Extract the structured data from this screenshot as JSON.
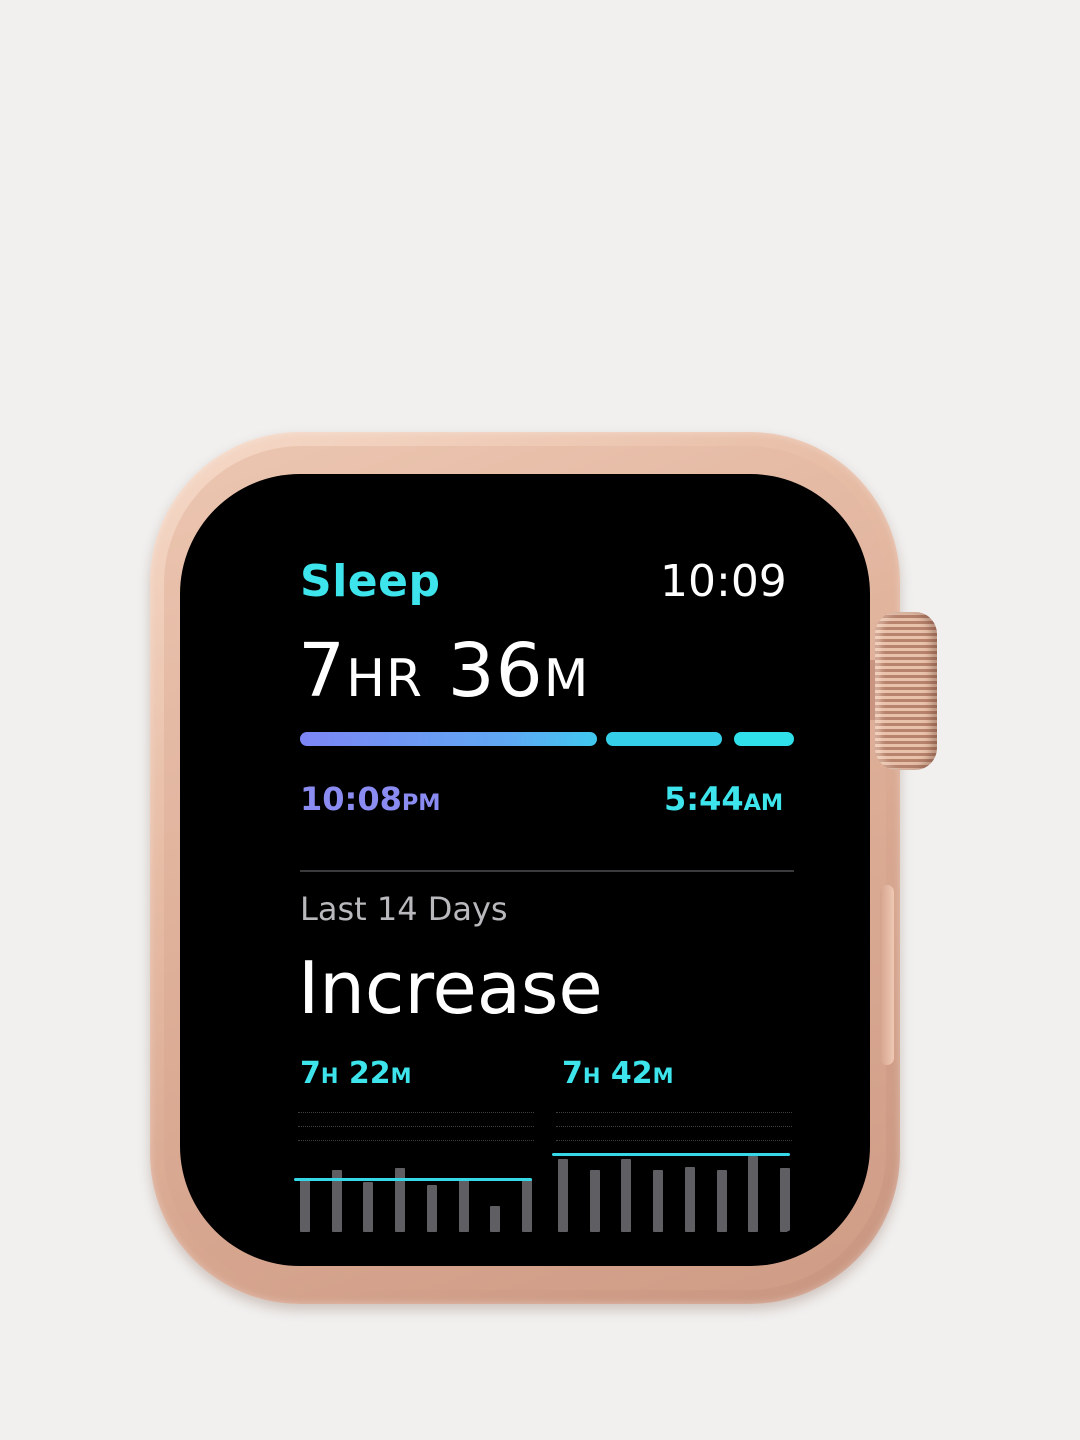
{
  "app": {
    "title": "Sleep",
    "clock": "10:09"
  },
  "summary": {
    "total_hours": "7",
    "hours_unit": "HR",
    "total_minutes": "36",
    "minutes_unit": "M",
    "start_time": "10:08",
    "start_period": "PM",
    "end_time": "5:44",
    "end_period": "AM"
  },
  "trend": {
    "period_label": "Last 14 Days",
    "headline": "Increase",
    "earlier_avg_hours": "7",
    "earlier_avg_minutes": "22",
    "recent_avg_hours": "7",
    "recent_avg_minutes": "42",
    "hours_unit": "H",
    "minutes_unit": "M"
  },
  "colors": {
    "accent_cyan": "#3de4ec",
    "accent_purple": "#8b8cf2",
    "bar_gray": "#5f5f63",
    "case_gold": "#e3b8a2"
  },
  "chart_data": {
    "type": "bar",
    "title": "",
    "series": [
      {
        "values": [
          0.62,
          0.72,
          0.58,
          0.75,
          0.55,
          0.6,
          0.3,
          0.62
        ]
      },
      {
        "values": [
          0.85,
          0.72,
          0.85,
          0.72,
          0.76,
          0.72,
          0.88,
          0.75
        ]
      }
    ],
    "averages": [
      0.6,
      0.9
    ],
    "ylim": [
      0,
      1
    ]
  }
}
